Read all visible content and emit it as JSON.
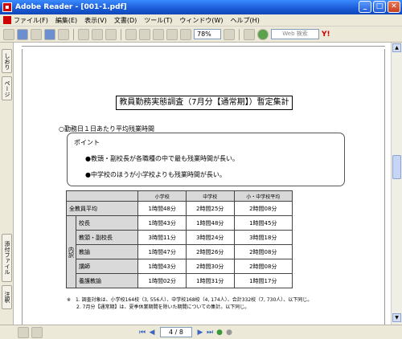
{
  "window": {
    "title": "Adobe Reader - [001-1.pdf]"
  },
  "menu": [
    "ファイル(F)",
    "編集(E)",
    "表示(V)",
    "文書(D)",
    "ツール(T)",
    "ウィンドウ(W)",
    "ヘルプ(H)"
  ],
  "toolbar": {
    "zoom_value": "78%",
    "search_placeholder": "Web 検索"
  },
  "sidebar": {
    "tabs": [
      "しおり",
      "ページ",
      "添付ファイル",
      "注釈"
    ]
  },
  "document": {
    "title": "教員勤務実態調査（7月分【通常期】）暫定集計",
    "subheading": "○勤務日１日あたり平均残業時間",
    "point_label": "ポイント",
    "bullets": [
      "●教頭・副校長が各職種の中で最も残業時間が長い。",
      "●中学校のほうが小学校よりも残業時間が長い。"
    ],
    "table": {
      "headers": [
        "",
        "小学校",
        "中学校",
        "小・中学校平均"
      ],
      "total_row": {
        "label": "全教員平均",
        "values": [
          "1時間48分",
          "2時間25分",
          "2時間08分"
        ]
      },
      "group_label": "内訳",
      "rows": [
        {
          "label": "校長",
          "values": [
            "1時間43分",
            "1時間48分",
            "1時間45分"
          ]
        },
        {
          "label": "教頭・副校長",
          "values": [
            "3時間11分",
            "3時間24分",
            "3時間18分"
          ]
        },
        {
          "label": "教諭",
          "values": [
            "1時間47分",
            "2時間26分",
            "2時間08分"
          ]
        },
        {
          "label": "講師",
          "values": [
            "1時間43分",
            "2時間30分",
            "2時間08分"
          ]
        },
        {
          "label": "養護教諭",
          "values": [
            "1時間02分",
            "1時間31分",
            "1時間17分"
          ]
        }
      ]
    },
    "notes": [
      "※　1. 調査対象は、小学校164校（3, 556人）、中学校168校（4, 174人）、合計332校（7, 730人）、以下同じ。",
      "　　2. 7月分【通常期】は、夏季休業期間を除いた期間についての集計。以下同じ。"
    ]
  },
  "statusbar": {
    "page": "4 / 8"
  }
}
